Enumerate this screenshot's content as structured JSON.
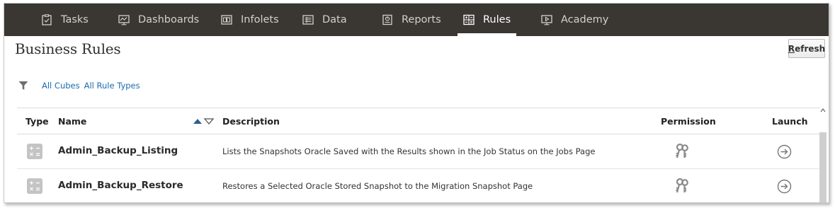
{
  "nav": {
    "items": [
      {
        "label": "Tasks",
        "icon": "tasks-icon"
      },
      {
        "label": "Dashboards",
        "icon": "dashboards-icon"
      },
      {
        "label": "Infolets",
        "icon": "infolets-icon"
      },
      {
        "label": "Data",
        "icon": "data-icon"
      },
      {
        "label": "Reports",
        "icon": "reports-icon"
      },
      {
        "label": "Rules",
        "icon": "rules-icon",
        "active": true
      },
      {
        "label": "Academy",
        "icon": "academy-icon"
      }
    ]
  },
  "page": {
    "title": "Business Rules",
    "refresh_label_prefix": "R",
    "refresh_label_rest": "efresh"
  },
  "filters": {
    "cubes": "All Cubes",
    "rule_types": "All Rule Types"
  },
  "table": {
    "headers": {
      "type": "Type",
      "name": "Name",
      "description": "Description",
      "permission": "Permission",
      "launch": "Launch"
    },
    "rows": [
      {
        "name": "Admin_Backup_Listing",
        "description": "Lists the Snapshots Oracle Saved with the Results shown in the Job Status on the Jobs Page"
      },
      {
        "name": "Admin_Backup_Restore",
        "description": "Restores a Selected Oracle Stored Snapshot to the Migration Snapshot Page"
      }
    ]
  },
  "colors": {
    "nav_bg": "#3a3632",
    "link": "#1a6cb0",
    "icon_gray": "#9a9a9a"
  }
}
